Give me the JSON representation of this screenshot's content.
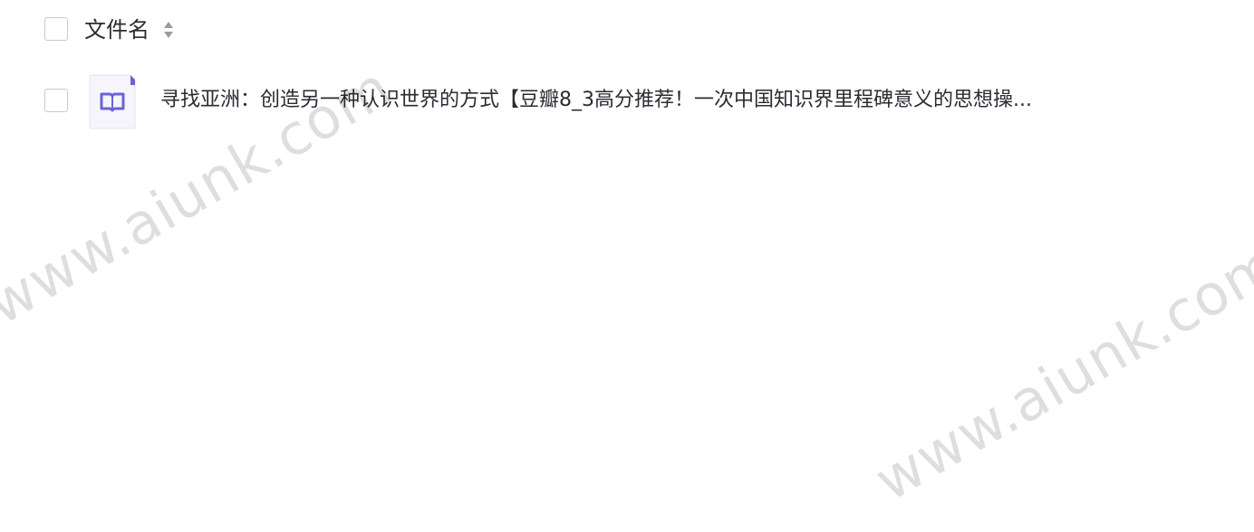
{
  "header": {
    "column_label": "文件名",
    "sort_icon": "sort-updown-icon"
  },
  "files": [
    {
      "icon": "book-icon",
      "name": "寻找亚洲：创造另一种认识世界的方式【豆瓣8_3高分推荐！一次中国知识界里程碑意义的思想操..."
    }
  ],
  "watermark": {
    "text_1": "www.aiunk.com",
    "text_2": "www.aiunk.com"
  },
  "colors": {
    "icon_accent": "#6a63d8",
    "icon_bg": "#f4f4fb",
    "text": "#2b2b33",
    "checkbox_border": "#c9c9cc"
  }
}
